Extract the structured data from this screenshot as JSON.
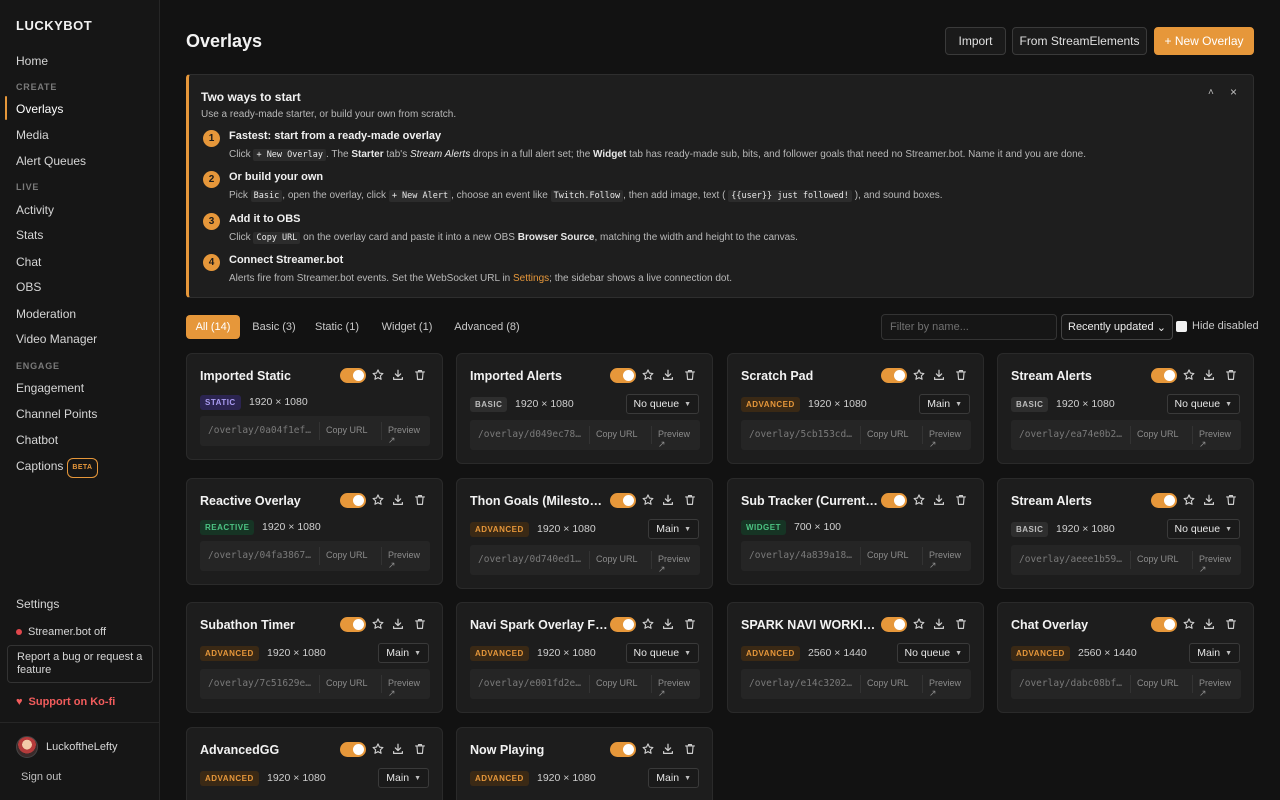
{
  "brand": "LUCKYBOT",
  "sidebar": {
    "home": "Home",
    "create_label": "CREATE",
    "overlays": "Overlays",
    "media": "Media",
    "alert_queues": "Alert Queues",
    "live_label": "LIVE",
    "activity": "Activity",
    "stats": "Stats",
    "chat": "Chat",
    "obs": "OBS",
    "moderation": "Moderation",
    "video_manager": "Video Manager",
    "engage_label": "ENGAGE",
    "engagement": "Engagement",
    "channel_points": "Channel Points",
    "chatbot": "Chatbot",
    "captions": "Captions",
    "beta": "BETA",
    "settings": "Settings",
    "status": "Streamer.bot off",
    "bug_report": "Report a bug or request a feature",
    "kofi": "Support on Ko-fi",
    "username": "LuckoftheLefty",
    "signout": "Sign out"
  },
  "header": {
    "title": "Overlays",
    "import": "Import",
    "from_se": "From StreamElements",
    "new_overlay": "+ New Overlay"
  },
  "info": {
    "title": "Two ways to start",
    "subtitle": "Use a ready-made starter, or build your own from scratch.",
    "collapse": "˄",
    "close": "×",
    "steps": [
      {
        "num": "1",
        "head": "Fastest: start from a ready-made overlay",
        "t1": "Click ",
        "c1": "+ New Overlay",
        "t2": ". The ",
        "b1": "Starter",
        "t3": " tab's ",
        "i1": "Stream Alerts",
        "t4": " drops in a full alert set; the ",
        "b2": "Widget",
        "t5": " tab has ready-made sub, bits, and follower goals that need no Streamer.bot. Name it and you are done."
      },
      {
        "num": "2",
        "head": "Or build your own",
        "t1": "Pick ",
        "c1": "Basic",
        "t2": ", open the overlay, click ",
        "c2": "+ New Alert",
        "t3": ", choose an event like ",
        "c3": "Twitch.Follow",
        "t4": ", then add image, text ( ",
        "c4": "{{user}} just followed!",
        "t5": " ), and sound boxes."
      },
      {
        "num": "3",
        "head": "Add it to OBS",
        "t1": "Click ",
        "c1": "Copy URL",
        "t2": " on the overlay card and paste it into a new OBS ",
        "b1": "Browser Source",
        "t3": ", matching the width and height to the canvas."
      },
      {
        "num": "4",
        "head": "Connect Streamer.bot",
        "t1": "Alerts fire from Streamer.bot events. Set the WebSocket URL in ",
        "l1": "Settings",
        "t2": "; the sidebar shows a live connection dot."
      }
    ]
  },
  "filters": {
    "tabs": [
      "All (14)",
      "Basic (3)",
      "Static (1)",
      "Widget (1)",
      "Advanced (8)"
    ],
    "search_placeholder": "Filter by name...",
    "sort": "Recently updated",
    "hide_disabled": "Hide disabled"
  },
  "card_labels": {
    "copy_url": "Copy URL",
    "preview": "Preview ↗"
  },
  "overlays": [
    {
      "name": "Imported Static",
      "type": "STATIC",
      "dims": "1920 × 1080",
      "queue": "",
      "url": "/overlay/0a04f1ef..."
    },
    {
      "name": "Imported Alerts",
      "type": "BASIC",
      "dims": "1920 × 1080",
      "queue": "No queue",
      "url": "/overlay/d049ec78..."
    },
    {
      "name": "Scratch Pad",
      "type": "ADVANCED",
      "dims": "1920 × 1080",
      "queue": "Main",
      "url": "/overlay/5cb153cd..."
    },
    {
      "name": "Stream Alerts",
      "type": "BASIC",
      "dims": "1920 × 1080",
      "queue": "No queue",
      "url": "/overlay/ea74e0b2..."
    },
    {
      "name": "Reactive Overlay",
      "type": "REACTIVE",
      "dims": "1920 × 1080",
      "queue": "",
      "url": "/overlay/04fa3867..."
    },
    {
      "name": "Thon Goals (Milestones)",
      "type": "ADVANCED",
      "dims": "1920 × 1080",
      "queue": "Main",
      "url": "/overlay/0d740ed1..."
    },
    {
      "name": "Sub Tracker (Current Total)",
      "type": "WIDGET",
      "dims": "700 × 100",
      "queue": "",
      "url": "/overlay/4a839a18..."
    },
    {
      "name": "Stream Alerts",
      "type": "BASIC",
      "dims": "1920 × 1080",
      "queue": "No queue",
      "url": "/overlay/aeee1b59..."
    },
    {
      "name": "Subathon Timer",
      "type": "ADVANCED",
      "dims": "1920 × 1080",
      "queue": "Main",
      "url": "/overlay/7c51629e..."
    },
    {
      "name": "Navi Spark Overlay Fix...",
      "type": "ADVANCED",
      "dims": "1920 × 1080",
      "queue": "No queue",
      "url": "/overlay/e001fd2e..."
    },
    {
      "name": "SPARK NAVI WORKING",
      "type": "ADVANCED",
      "dims": "2560 × 1440",
      "queue": "No queue",
      "url": "/overlay/e14c3202..."
    },
    {
      "name": "Chat Overlay",
      "type": "ADVANCED",
      "dims": "2560 × 1440",
      "queue": "Main",
      "url": "/overlay/dabc08bf..."
    },
    {
      "name": "AdvancedGG",
      "type": "ADVANCED",
      "dims": "1920 × 1080",
      "queue": "Main",
      "url": ""
    },
    {
      "name": "Now Playing",
      "type": "ADVANCED",
      "dims": "1920 × 1080",
      "queue": "Main",
      "url": ""
    }
  ],
  "colors": {
    "accent": "#e6973a",
    "background": "#121212",
    "card": "#1d1d1d",
    "status_off": "#e0474c",
    "kofi": "#f25c5c"
  }
}
